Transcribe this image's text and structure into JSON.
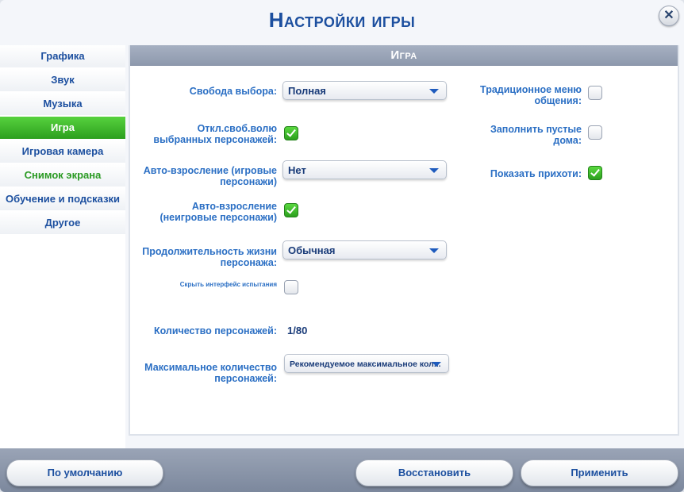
{
  "window": {
    "title": "Настройки игры",
    "close_icon": "close-icon"
  },
  "sidebar": {
    "items": [
      {
        "label": "Графика",
        "state": "normal"
      },
      {
        "label": "Звук",
        "state": "normal"
      },
      {
        "label": "Музыка",
        "state": "normal"
      },
      {
        "label": "Игра",
        "state": "active"
      },
      {
        "label": "Игровая камера",
        "state": "normal"
      },
      {
        "label": "Снимок экрана",
        "state": "highlight"
      },
      {
        "label": "Обучение и подсказки",
        "state": "normal"
      },
      {
        "label": "Другое",
        "state": "normal"
      }
    ]
  },
  "panel": {
    "header": "Игра",
    "free_will": {
      "label": "Свобода выбора:",
      "value": "Полная"
    },
    "disable_free_will": {
      "label": "Откл.своб.волю выбранных персонажей:",
      "checked": true
    },
    "auto_aging_played": {
      "label": "Авто-взросление (игровые персонажи)",
      "value": "Нет"
    },
    "auto_aging_unplayed": {
      "label": "Авто-взросление (неигровые персонажи)",
      "checked": true
    },
    "lifespan": {
      "label": "Продолжительность жизни персонажа:",
      "value": "Обычная"
    },
    "hide_trial_ui": {
      "label": "Скрыть интерфейс испытания",
      "checked": false
    },
    "sim_count": {
      "label": "Количество персонажей:",
      "value": "1/80"
    },
    "max_sims": {
      "label": "Максимальное количество персонажей:",
      "value": "Рекомендуемое максимальное кол..."
    },
    "classic_social_menu": {
      "label": "Традиционное меню общения:",
      "checked": false
    },
    "fill_empty_houses": {
      "label": "Заполнить пустые дома:",
      "checked": false
    },
    "show_whims": {
      "label": "Показать прихоти:",
      "checked": true
    }
  },
  "footer": {
    "defaults_label": "По умолчанию",
    "restore_label": "Восстановить",
    "apply_label": "Применить"
  },
  "colors": {
    "accent_blue": "#1c4f9f",
    "active_green": "#3bbd2a",
    "label_blue": "#2b6fc4"
  }
}
